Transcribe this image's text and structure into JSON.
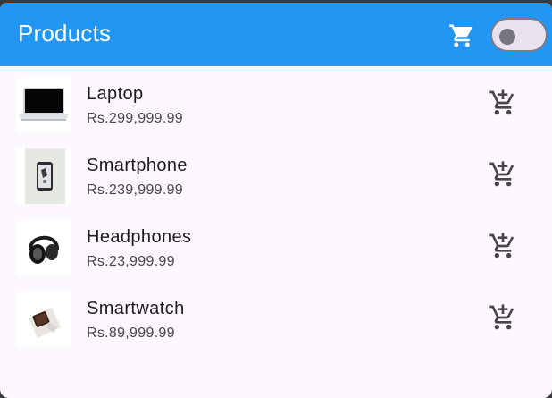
{
  "appbar": {
    "title": "Products",
    "cart_icon": "shopping-cart-icon",
    "toggle": {
      "state": "off"
    },
    "color": "#2196f3"
  },
  "products": [
    {
      "name": "Laptop",
      "price": "Rs.299,999.99",
      "thumb_icon": "laptop-image",
      "action_icon": "add-shopping-cart-icon"
    },
    {
      "name": "Smartphone",
      "price": "Rs.239,999.99",
      "thumb_icon": "smartphone-image",
      "action_icon": "add-shopping-cart-icon"
    },
    {
      "name": "Headphones",
      "price": "Rs.23,999.99",
      "thumb_icon": "headphones-image",
      "action_icon": "add-shopping-cart-icon"
    },
    {
      "name": "Smartwatch",
      "price": "Rs.89,999.99",
      "thumb_icon": "smartwatch-image",
      "action_icon": "add-shopping-cart-icon"
    }
  ]
}
